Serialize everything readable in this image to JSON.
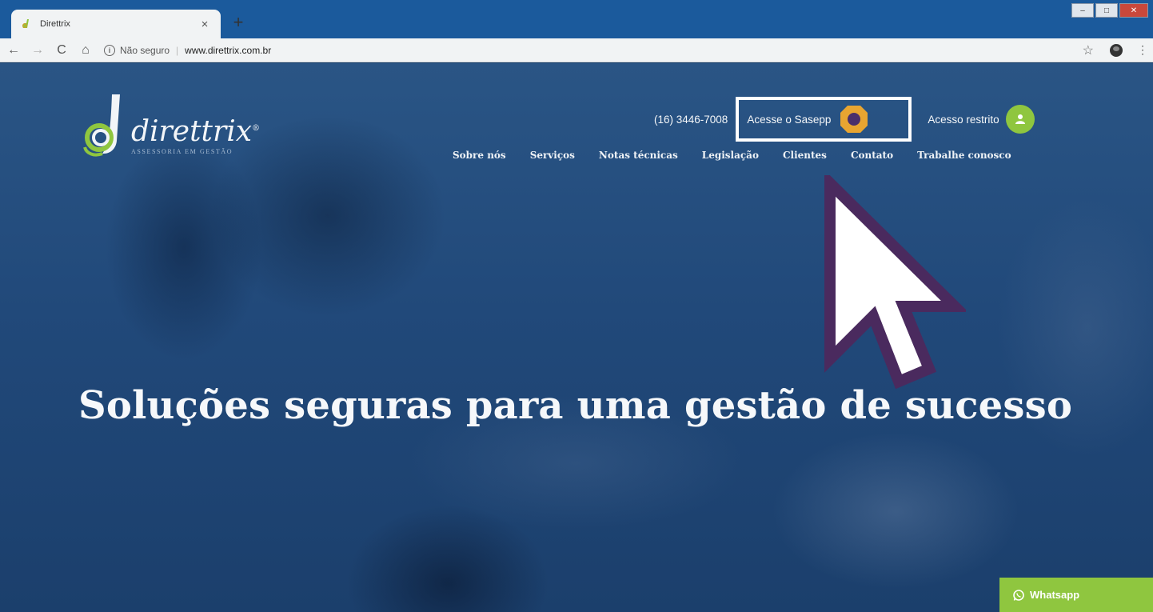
{
  "browser": {
    "tab_title": "Direttrix",
    "tab_close": "×",
    "new_tab": "+",
    "security_label": "Não seguro",
    "url_separator": "|",
    "url": "www.direttrix.com.br",
    "info_glyph": "i",
    "back_glyph": "←",
    "forward_glyph": "→",
    "reload_glyph": "C",
    "home_glyph": "⌂",
    "star_glyph": "☆",
    "menu_glyph": "⋮",
    "minimize_glyph": "–",
    "maximize_glyph": "□",
    "close_glyph": "✕"
  },
  "site": {
    "logo_word": "direttrix",
    "logo_registered": "®",
    "logo_tagline": "ASSESSORIA EM GESTÃO",
    "phone": "(16) 3446-7008",
    "sasepp_label": "Acesse o Sasepp",
    "restricted_label": "Acesso restrito",
    "nav": [
      "Sobre nós",
      "Serviços",
      "Notas técnicas",
      "Legislação",
      "Clientes",
      "Contato",
      "Trabalhe conosco"
    ],
    "hero_title": "Soluções seguras para uma gestão de sucesso",
    "whatsapp_label": "Whatsapp"
  },
  "colors": {
    "accent_green": "#8fc63f",
    "sasepp_orange": "#e8a531",
    "sasepp_purple": "#4a2f6b",
    "cursor_outline": "#4a2a5e",
    "chrome_blue": "#1b5a9c"
  },
  "icons": {
    "favicon": "direttrix-favicon",
    "user": "user-icon",
    "whatsapp": "whatsapp-icon",
    "pointer": "mouse-pointer-icon"
  }
}
